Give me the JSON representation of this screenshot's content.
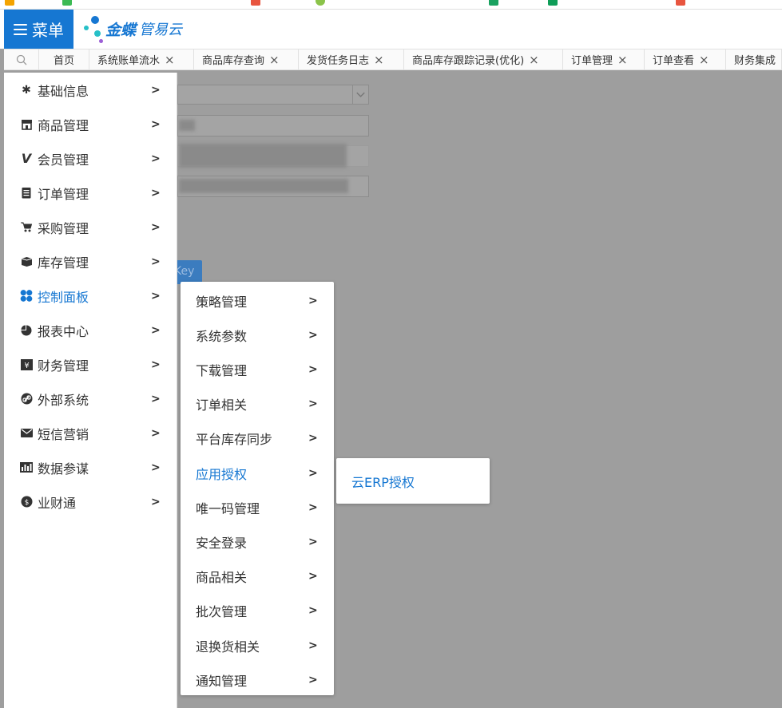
{
  "header": {
    "menu_label": "菜单",
    "brand_name": "金蝶",
    "product_name": "管易云"
  },
  "tabs": [
    {
      "label": "首页",
      "closable": false
    },
    {
      "label": "系统账单流水",
      "closable": true
    },
    {
      "label": "商品库存查询",
      "closable": true
    },
    {
      "label": "发货任务日志",
      "closable": true
    },
    {
      "label": "商品库存跟踪记录(优化)",
      "closable": true
    },
    {
      "label": "订单管理",
      "closable": true
    },
    {
      "label": "订单查看",
      "closable": true
    },
    {
      "label": "财务集成",
      "closable": false
    }
  ],
  "main_menu": [
    {
      "label": "基础信息",
      "icon": "gear-icon"
    },
    {
      "label": "商品管理",
      "icon": "store-icon"
    },
    {
      "label": "会员管理",
      "icon": "vip-icon"
    },
    {
      "label": "订单管理",
      "icon": "clipboard-icon"
    },
    {
      "label": "采购管理",
      "icon": "cart-icon"
    },
    {
      "label": "库存管理",
      "icon": "box-icon"
    },
    {
      "label": "控制面板",
      "icon": "dashboard-icon",
      "active": true
    },
    {
      "label": "报表中心",
      "icon": "pie-chart-icon"
    },
    {
      "label": "财务管理",
      "icon": "yen-icon"
    },
    {
      "label": "外部系统",
      "icon": "link-icon"
    },
    {
      "label": "短信营销",
      "icon": "mail-icon"
    },
    {
      "label": "数据参谋",
      "icon": "bar-chart-icon"
    },
    {
      "label": "业财通",
      "icon": "money-bag-icon"
    }
  ],
  "sub_menu": [
    {
      "label": "策略管理"
    },
    {
      "label": "系统参数"
    },
    {
      "label": "下载管理"
    },
    {
      "label": "订单相关"
    },
    {
      "label": "平台库存同步"
    },
    {
      "label": "应用授权",
      "active": true
    },
    {
      "label": "唯一码管理"
    },
    {
      "label": "安全登录"
    },
    {
      "label": "商品相关"
    },
    {
      "label": "批次管理"
    },
    {
      "label": "退换货相关"
    },
    {
      "label": "通知管理"
    }
  ],
  "third_menu": [
    {
      "label": "云ERP授权"
    }
  ],
  "ghost_button_text": "Key",
  "colors": {
    "accent": "#1677d2",
    "overlay": "#9e9e9e"
  }
}
